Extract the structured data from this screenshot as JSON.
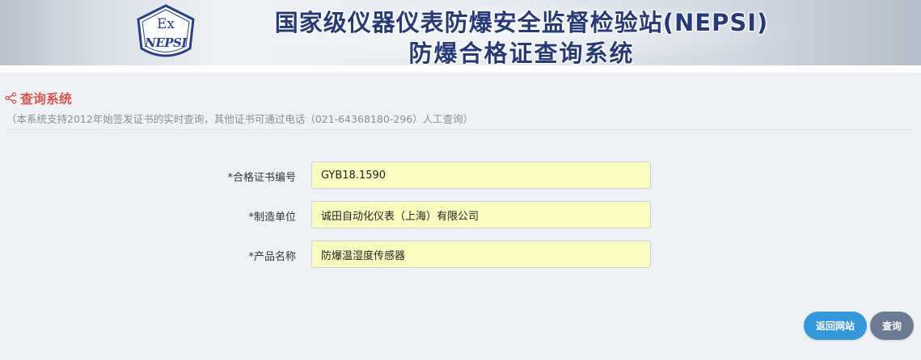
{
  "banner": {
    "title_line1": "国家级仪器仪表防爆安全监督检验站(NEPSI)",
    "title_line2": "防爆合格证查询系统",
    "logo_text_top": "Ex",
    "logo_text_bottom": "NEPSI"
  },
  "section": {
    "icon": "share-icon",
    "title": "查询系统",
    "note": "（本系统支持2012年始签发证书的实时查询，其他证书可通过电话（021-64368180-296）人工查询）"
  },
  "form": {
    "fields": [
      {
        "label": "*合格证书编号",
        "value": "GYB18.1590"
      },
      {
        "label": "*制造单位",
        "value": "诚田自动化仪表（上海）有限公司"
      },
      {
        "label": "*产品名称",
        "value": "防爆温湿度传感器"
      }
    ]
  },
  "buttons": {
    "back_label": "返回网站",
    "query_label": "查询"
  },
  "colors": {
    "section_title": "#d9534f",
    "input_bg": "#fbfcbf",
    "back_button": "#3498db",
    "query_button": "#6b7b93",
    "banner_text": "#263a78"
  }
}
